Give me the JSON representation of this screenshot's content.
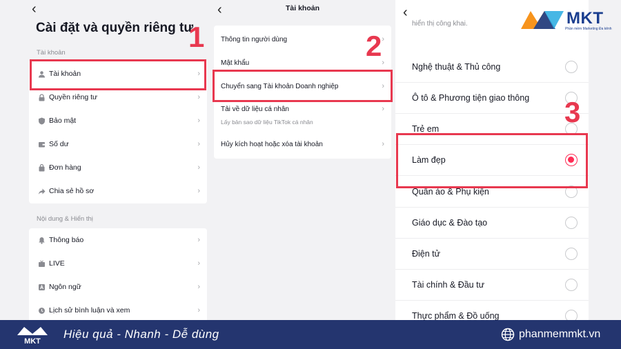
{
  "panel1": {
    "title": "Cài đặt và quyền riêng tư",
    "section_account": "Tài khoản",
    "account_items": [
      {
        "label": "Tài khoản",
        "icon": "user-icon"
      },
      {
        "label": "Quyền riêng tư",
        "icon": "lock-icon"
      },
      {
        "label": "Bảo mật",
        "icon": "shield-icon"
      },
      {
        "label": "Số dư",
        "icon": "wallet-icon"
      },
      {
        "label": "Đơn hàng",
        "icon": "bag-icon"
      },
      {
        "label": "Chia sẻ hồ sơ",
        "icon": "share-icon"
      }
    ],
    "section_content": "Nội dung & Hiển thị",
    "content_items": [
      {
        "label": "Thông báo",
        "icon": "bell-icon"
      },
      {
        "label": "LIVE",
        "icon": "live-icon"
      },
      {
        "label": "Ngôn ngữ",
        "icon": "language-icon"
      },
      {
        "label": "Lịch sử bình luận và xem",
        "icon": "history-icon"
      }
    ]
  },
  "panel2": {
    "title": "Tài khoản",
    "items": [
      {
        "label": "Thông tin người dùng"
      },
      {
        "label": "Mật khẩu"
      },
      {
        "label": "Chuyển sang Tài khoản Doanh nghiệp"
      },
      {
        "label": "Tải về dữ liệu cá nhân",
        "sub": "Lấy bản sao dữ liệu TikTok cá nhân"
      },
      {
        "label": "Hủy kích hoạt hoặc xóa tài khoản"
      }
    ]
  },
  "panel3": {
    "top_text": "hiển thị công khai.",
    "categories": [
      {
        "label": "Nghệ thuật & Thủ công",
        "selected": false
      },
      {
        "label": "Ô tô & Phương tiện giao thông",
        "selected": false
      },
      {
        "label": "Trẻ em",
        "selected": false
      },
      {
        "label": "Làm đẹp",
        "selected": true
      },
      {
        "label": "Quần áo & Phụ kiện",
        "selected": false
      },
      {
        "label": "Giáo dục & Đào tạo",
        "selected": false
      },
      {
        "label": "Điện tử",
        "selected": false
      },
      {
        "label": "Tài chính & Đầu tư",
        "selected": false
      },
      {
        "label": "Thực phẩm & Đồ uống",
        "selected": false
      }
    ]
  },
  "steps": [
    "1",
    "2",
    "3"
  ],
  "brand": {
    "name": "MKT",
    "tagline": "Phần mềm Marketing Đa kênh",
    "slogan": "Hiệu quả - Nhanh - Dễ dùng",
    "website": "phanmemmkt.vn",
    "footer_color": "#24356f",
    "accent_color": "#e8384f",
    "radio_color": "#fe2c55"
  }
}
